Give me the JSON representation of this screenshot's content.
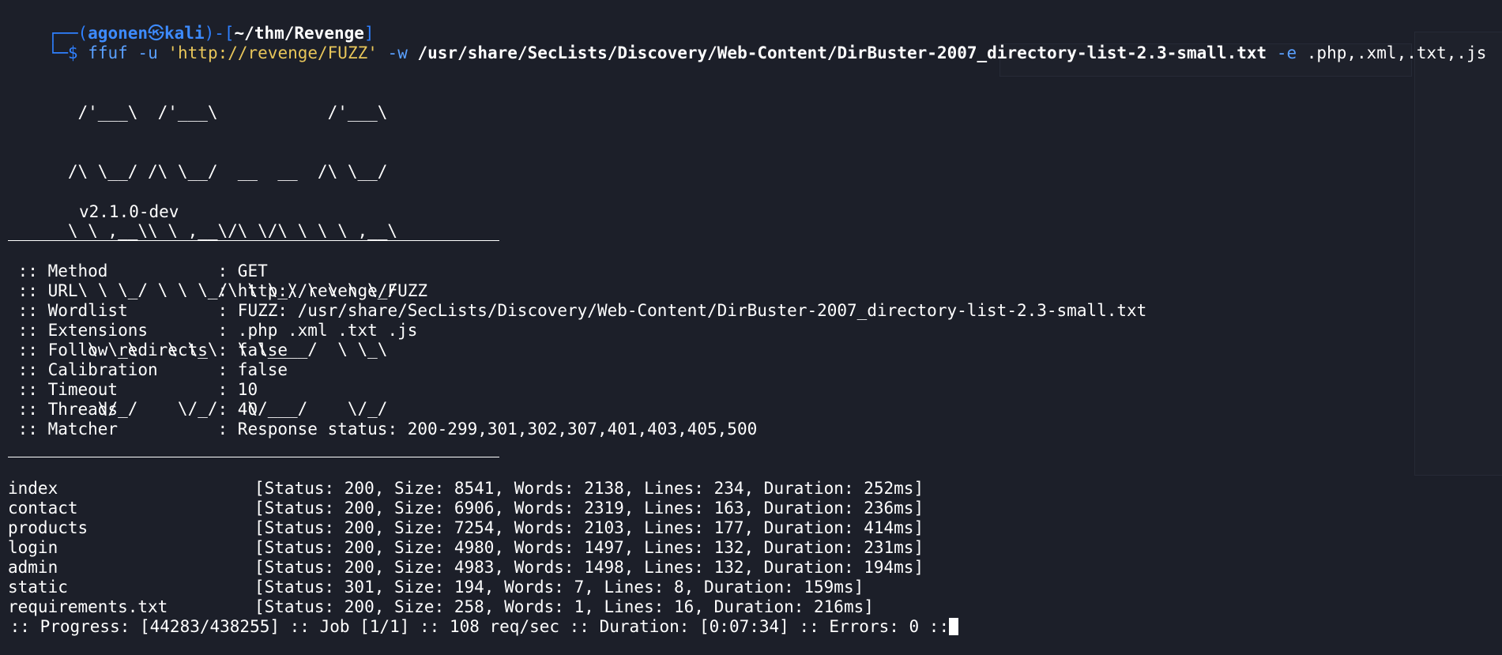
{
  "prompt": {
    "user": "agonen",
    "host": "kali",
    "path": "~/thm/Revenge",
    "symbol": "$"
  },
  "command": {
    "program": "ffuf",
    "flag_u": "-u",
    "url": "'http://revenge/FUZZ'",
    "flag_w": "-w",
    "wordlist": "/usr/share/SecLists/Discovery/Web-Content/DirBuster-2007_directory-list-2.3-small.txt",
    "flag_e": "-e",
    "extensions": ".php,.xml,.txt,.js"
  },
  "banner": {
    "art": [
      "       /'___\\  /'___\\           /'___\\",
      "      /\\ \\__/ /\\ \\__/  __  __  /\\ \\__/",
      "      \\ \\ ,__\\\\ \\ ,__\\/\\ \\/\\ \\ \\ \\ ,__\\",
      "       \\ \\ \\_/ \\ \\ \\_/\\ \\ \\_\\ \\ \\ \\ \\_/",
      "        \\ \\_\\   \\ \\_\\  \\ \\____/  \\ \\_\\",
      "         \\/_/    \\/_/   \\/___/    \\/_/"
    ],
    "version": "v2.1.0-dev"
  },
  "config": [
    {
      "key": " :: Method           ",
      "value": ": GET"
    },
    {
      "key": " :: URL              ",
      "value": ": http://revenge/FUZZ"
    },
    {
      "key": " :: Wordlist         ",
      "value": ": FUZZ: /usr/share/SecLists/Discovery/Web-Content/DirBuster-2007_directory-list-2.3-small.txt"
    },
    {
      "key": " :: Extensions       ",
      "value": ": .php .xml .txt .js"
    },
    {
      "key": " :: Follow redirects ",
      "value": ": false"
    },
    {
      "key": " :: Calibration      ",
      "value": ": false"
    },
    {
      "key": " :: Timeout          ",
      "value": ": 10"
    },
    {
      "key": " :: Threads          ",
      "value": ": 40"
    },
    {
      "key": " :: Matcher          ",
      "value": ": Response status: 200-299,301,302,307,401,403,405,500"
    }
  ],
  "results": [
    {
      "name": "index",
      "info": "[Status: 200, Size: 8541, Words: 2138, Lines: 234, Duration: 252ms]"
    },
    {
      "name": "contact",
      "info": "[Status: 200, Size: 6906, Words: 2319, Lines: 163, Duration: 236ms]"
    },
    {
      "name": "products",
      "info": "[Status: 200, Size: 7254, Words: 2103, Lines: 177, Duration: 414ms]"
    },
    {
      "name": "login",
      "info": "[Status: 200, Size: 4980, Words: 1497, Lines: 132, Duration: 231ms]"
    },
    {
      "name": "admin",
      "info": "[Status: 200, Size: 4983, Words: 1498, Lines: 132, Duration: 194ms]"
    },
    {
      "name": "static",
      "info": "[Status: 301, Size: 194, Words: 7, Lines: 8, Duration: 159ms]"
    },
    {
      "name": "requirements.txt",
      "info": "[Status: 200, Size: 258, Words: 1, Lines: 16, Duration: 216ms]"
    }
  ],
  "progress": " :: Progress: [44283/438255] :: Job [1/1] :: 108 req/sec :: Duration: [0:07:34] :: Errors: 0 ::",
  "colors": {
    "background": "#1c1f29",
    "prompt_blue": "#3d8bff",
    "string_yellow": "#e8c65a",
    "text": "#ffffff"
  }
}
